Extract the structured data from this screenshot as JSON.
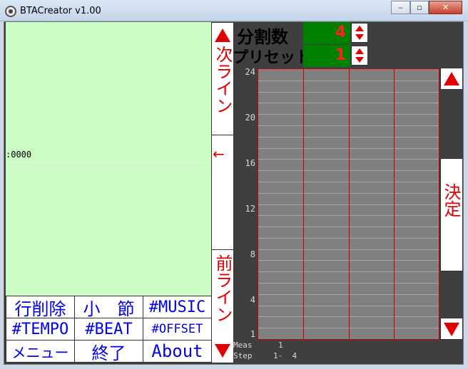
{
  "window": {
    "title": "BTACreator v1.00",
    "minimize": "‒",
    "maximize": "▫",
    "close": "✕"
  },
  "editor": {
    "position_text": ":0000",
    "arrow": "←"
  },
  "side_buttons": {
    "next_line": "次ライン",
    "prev_line": "前ライン",
    "decide": "決定"
  },
  "menu": {
    "row1": [
      "行削除",
      "小　節",
      "#MUSIC"
    ],
    "row2": [
      "#TEMPO",
      "#BEAT",
      "#OFFSET"
    ],
    "row3": [
      "メニュー",
      "終了",
      "About"
    ]
  },
  "header": {
    "divisions_label": "分割数",
    "divisions_value": "4",
    "preset_label": "プリセット",
    "preset_value": "1"
  },
  "grid": {
    "y_ticks": [
      "24",
      "20",
      "16",
      "12",
      "8",
      "4",
      "1"
    ],
    "columns": 4,
    "rows": 24
  },
  "status": {
    "meas_label": "Meas",
    "meas_value": "1",
    "step_label": "Step",
    "step_value": "1-  4"
  },
  "colors": {
    "edit_bg": "#ccfdc4",
    "accent_red": "#e00000",
    "menu_blue": "#0000ee",
    "number_box": "#008000"
  }
}
